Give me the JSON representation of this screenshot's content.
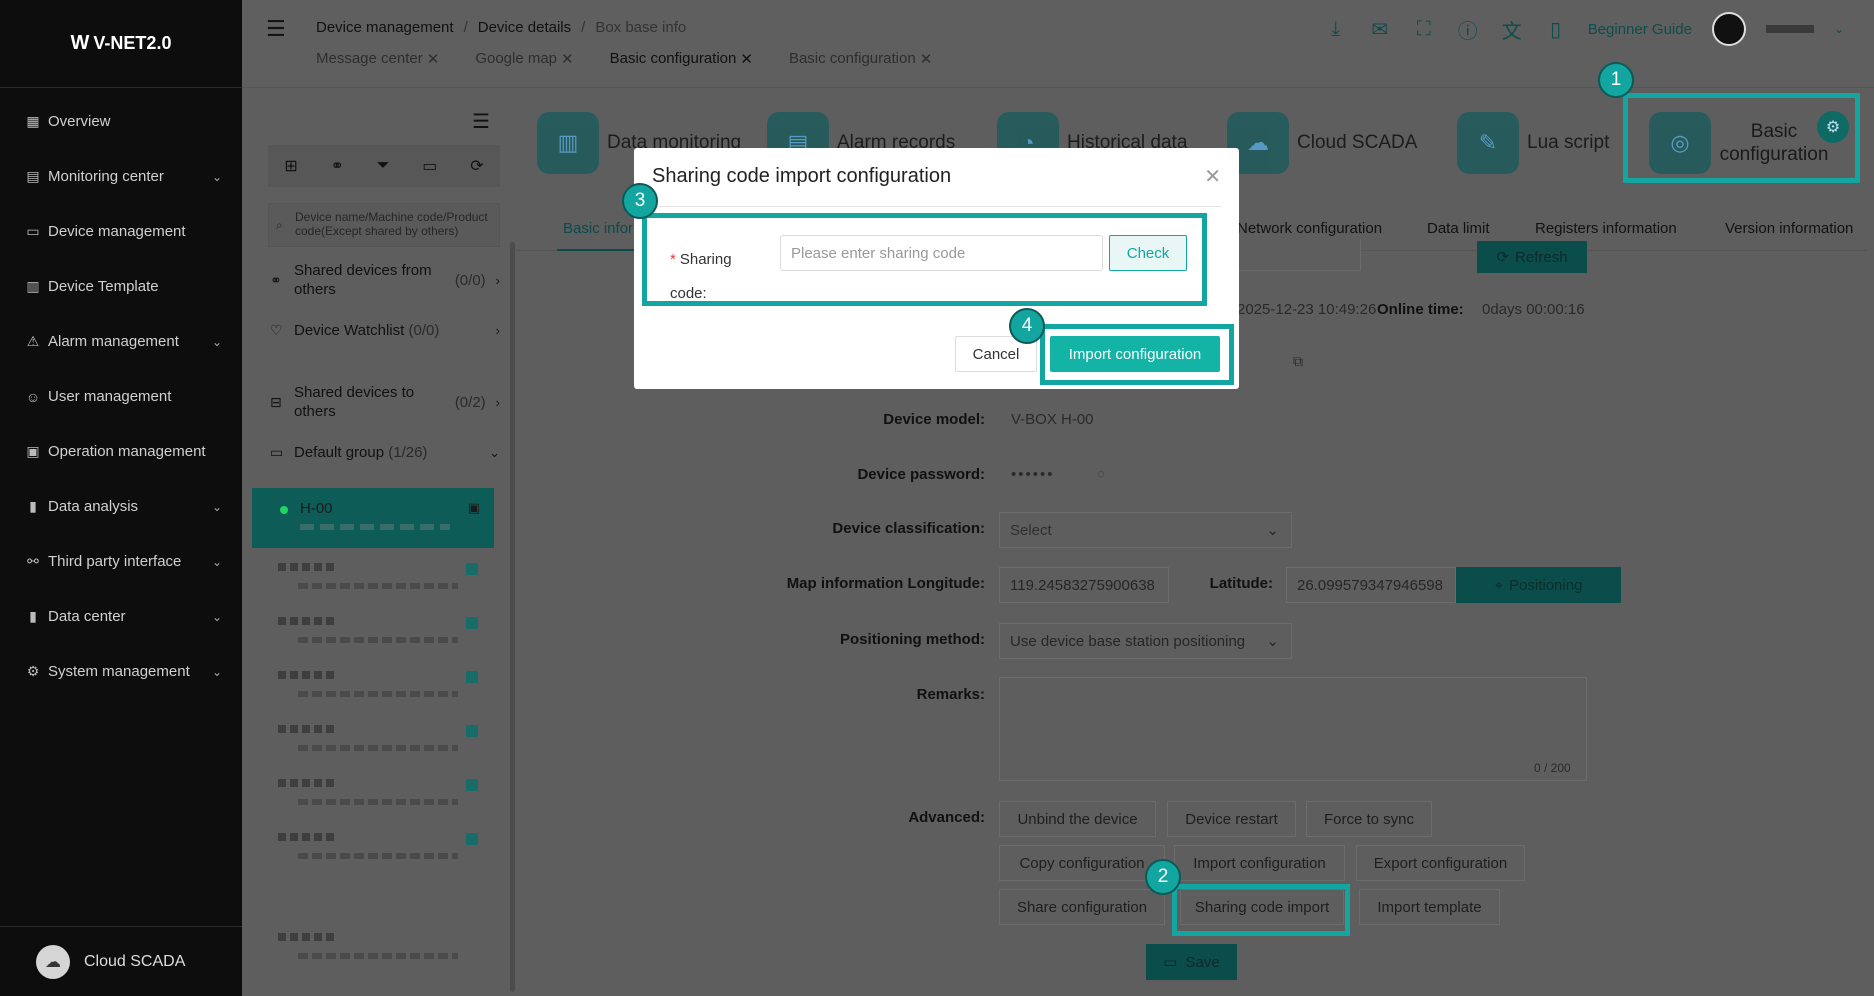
{
  "app": {
    "logo_text": "V-NET2.0",
    "logo_mark": "W"
  },
  "sidebar": {
    "items": [
      {
        "label": "Overview",
        "icon": "grid-icon",
        "glyph": "▦",
        "chevron": false
      },
      {
        "label": "Monitoring center",
        "icon": "monitor-icon",
        "glyph": "▤",
        "chevron": true
      },
      {
        "label": "Device management",
        "icon": "device-icon",
        "glyph": "▭",
        "chevron": false
      },
      {
        "label": "Device Template",
        "icon": "template-icon",
        "glyph": "▥",
        "chevron": false
      },
      {
        "label": "Alarm management",
        "icon": "alarm-icon",
        "glyph": "⚠",
        "chevron": true
      },
      {
        "label": "User management",
        "icon": "user-icon",
        "glyph": "☺",
        "chevron": false
      },
      {
        "label": "Operation management",
        "icon": "operation-icon",
        "glyph": "▣",
        "chevron": false
      },
      {
        "label": "Data analysis",
        "icon": "bar-chart-icon",
        "glyph": "▮",
        "chevron": true
      },
      {
        "label": "Third party interface",
        "icon": "network-icon",
        "glyph": "⚯",
        "chevron": true
      },
      {
        "label": "Data center",
        "icon": "data-icon",
        "glyph": "▮",
        "chevron": true
      },
      {
        "label": "System management",
        "icon": "system-icon",
        "glyph": "⚙",
        "chevron": true
      }
    ],
    "footer_label": "Cloud SCADA"
  },
  "topbar": {
    "breadcrumb": [
      "Device management",
      "Device details",
      "Box base info"
    ],
    "tabs": [
      {
        "label": "Message center",
        "active": false
      },
      {
        "label": "Google map",
        "active": false
      },
      {
        "label": "Basic configuration",
        "active": true
      },
      {
        "label": "Basic configuration",
        "active": false
      }
    ],
    "guide_label": "Beginner Guide"
  },
  "device_panel": {
    "search_placeholder": "Device name/Machine code/Product code(Except shared by others)",
    "shared_from": {
      "label": "Shared devices from others",
      "count": "(0/0)"
    },
    "watchlist": {
      "label": "Device Watchlist",
      "count": "(0/0)"
    },
    "shared_to": {
      "label": "Shared devices to others",
      "count": "(0/2)"
    },
    "group": {
      "label": "Default group",
      "count": "(1/26)"
    },
    "active_device": "H-00"
  },
  "features": [
    {
      "label": "Data monitoring",
      "icon": "data-monitoring-icon"
    },
    {
      "label": "Alarm records",
      "icon": "alarm-records-icon"
    },
    {
      "label": "Historical data",
      "icon": "historical-data-icon"
    },
    {
      "label": "Cloud SCADA",
      "icon": "cloud-scada-icon"
    },
    {
      "label": "Lua script",
      "icon": "lua-script-icon"
    }
  ],
  "basic_config_feature": "Basic configuration",
  "sub_tabs": {
    "basic": "Basic infor",
    "network": "Network configuration",
    "data_limit": "Data limit",
    "registers": "Registers information",
    "version": "Version information"
  },
  "form": {
    "refresh_label": "Refresh",
    "timestamp": "2025-12-23 10:49:26",
    "online_label": "Online time:",
    "online_value": "0days 00:00:16",
    "model_label": "Device model:",
    "model_value": "V-BOX H-00",
    "password_label": "Device password:",
    "password_value": "••••••",
    "classification_label": "Device classification:",
    "classification_placeholder": "Select",
    "longitude_label": "Map information Longitude:",
    "longitude_value": "119.24583275900638",
    "latitude_label": "Latitude:",
    "latitude_value": "26.099579347946598",
    "positioning_label": "Positioning",
    "method_label": "Positioning method:",
    "method_value": "Use device base station positioning",
    "remarks_label": "Remarks:",
    "remarks_counter": "0 / 200",
    "advanced_label": "Advanced:",
    "advanced_buttons": {
      "unbind": "Unbind the device",
      "restart": "Device restart",
      "sync": "Force to sync",
      "copy": "Copy configuration",
      "import": "Import configuration",
      "export": "Export configuration",
      "share": "Share configuration",
      "sharing_import": "Sharing code import",
      "template": "Import template"
    },
    "save_label": "Save"
  },
  "modal": {
    "title": "Sharing code import configuration",
    "required_mark": "*",
    "label": "Sharing code:",
    "input_placeholder": "Please enter sharing code",
    "check_label": "Check",
    "cancel_label": "Cancel",
    "import_label": "Import configuration"
  },
  "badges": [
    "1",
    "2",
    "3",
    "4"
  ],
  "colors": {
    "accent": "#13a6a0",
    "import_button": "#13b3a6",
    "sidebar_bg": "#0d0d0d"
  }
}
